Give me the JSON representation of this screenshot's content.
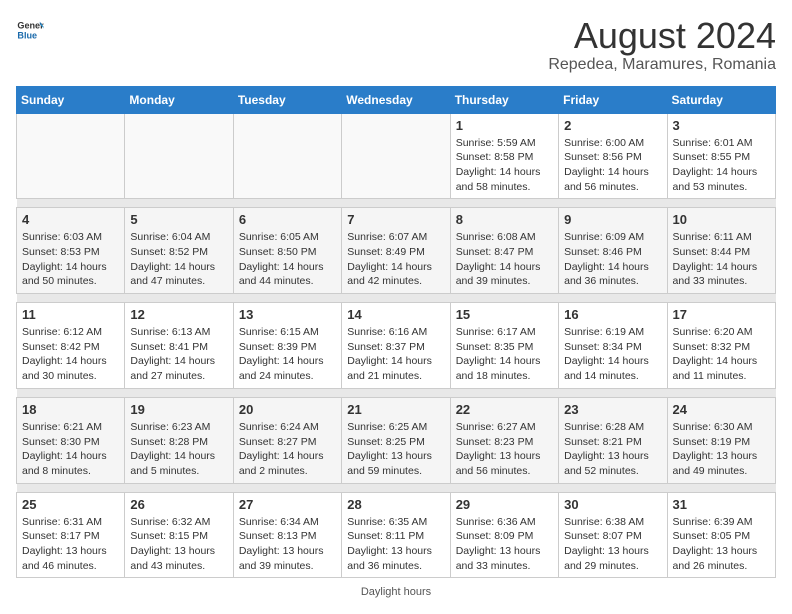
{
  "header": {
    "logo_general": "General",
    "logo_blue": "Blue",
    "main_title": "August 2024",
    "sub_title": "Repedea, Maramures, Romania"
  },
  "days_of_week": [
    "Sunday",
    "Monday",
    "Tuesday",
    "Wednesday",
    "Thursday",
    "Friday",
    "Saturday"
  ],
  "footer": {
    "daylight_note": "Daylight hours"
  },
  "weeks": [
    {
      "days": [
        {
          "num": "",
          "info": ""
        },
        {
          "num": "",
          "info": ""
        },
        {
          "num": "",
          "info": ""
        },
        {
          "num": "",
          "info": ""
        },
        {
          "num": "1",
          "info": "Sunrise: 5:59 AM\nSunset: 8:58 PM\nDaylight: 14 hours\nand 58 minutes."
        },
        {
          "num": "2",
          "info": "Sunrise: 6:00 AM\nSunset: 8:56 PM\nDaylight: 14 hours\nand 56 minutes."
        },
        {
          "num": "3",
          "info": "Sunrise: 6:01 AM\nSunset: 8:55 PM\nDaylight: 14 hours\nand 53 minutes."
        }
      ]
    },
    {
      "days": [
        {
          "num": "4",
          "info": "Sunrise: 6:03 AM\nSunset: 8:53 PM\nDaylight: 14 hours\nand 50 minutes."
        },
        {
          "num": "5",
          "info": "Sunrise: 6:04 AM\nSunset: 8:52 PM\nDaylight: 14 hours\nand 47 minutes."
        },
        {
          "num": "6",
          "info": "Sunrise: 6:05 AM\nSunset: 8:50 PM\nDaylight: 14 hours\nand 44 minutes."
        },
        {
          "num": "7",
          "info": "Sunrise: 6:07 AM\nSunset: 8:49 PM\nDaylight: 14 hours\nand 42 minutes."
        },
        {
          "num": "8",
          "info": "Sunrise: 6:08 AM\nSunset: 8:47 PM\nDaylight: 14 hours\nand 39 minutes."
        },
        {
          "num": "9",
          "info": "Sunrise: 6:09 AM\nSunset: 8:46 PM\nDaylight: 14 hours\nand 36 minutes."
        },
        {
          "num": "10",
          "info": "Sunrise: 6:11 AM\nSunset: 8:44 PM\nDaylight: 14 hours\nand 33 minutes."
        }
      ]
    },
    {
      "days": [
        {
          "num": "11",
          "info": "Sunrise: 6:12 AM\nSunset: 8:42 PM\nDaylight: 14 hours\nand 30 minutes."
        },
        {
          "num": "12",
          "info": "Sunrise: 6:13 AM\nSunset: 8:41 PM\nDaylight: 14 hours\nand 27 minutes."
        },
        {
          "num": "13",
          "info": "Sunrise: 6:15 AM\nSunset: 8:39 PM\nDaylight: 14 hours\nand 24 minutes."
        },
        {
          "num": "14",
          "info": "Sunrise: 6:16 AM\nSunset: 8:37 PM\nDaylight: 14 hours\nand 21 minutes."
        },
        {
          "num": "15",
          "info": "Sunrise: 6:17 AM\nSunset: 8:35 PM\nDaylight: 14 hours\nand 18 minutes."
        },
        {
          "num": "16",
          "info": "Sunrise: 6:19 AM\nSunset: 8:34 PM\nDaylight: 14 hours\nand 14 minutes."
        },
        {
          "num": "17",
          "info": "Sunrise: 6:20 AM\nSunset: 8:32 PM\nDaylight: 14 hours\nand 11 minutes."
        }
      ]
    },
    {
      "days": [
        {
          "num": "18",
          "info": "Sunrise: 6:21 AM\nSunset: 8:30 PM\nDaylight: 14 hours\nand 8 minutes."
        },
        {
          "num": "19",
          "info": "Sunrise: 6:23 AM\nSunset: 8:28 PM\nDaylight: 14 hours\nand 5 minutes."
        },
        {
          "num": "20",
          "info": "Sunrise: 6:24 AM\nSunset: 8:27 PM\nDaylight: 14 hours\nand 2 minutes."
        },
        {
          "num": "21",
          "info": "Sunrise: 6:25 AM\nSunset: 8:25 PM\nDaylight: 13 hours\nand 59 minutes."
        },
        {
          "num": "22",
          "info": "Sunrise: 6:27 AM\nSunset: 8:23 PM\nDaylight: 13 hours\nand 56 minutes."
        },
        {
          "num": "23",
          "info": "Sunrise: 6:28 AM\nSunset: 8:21 PM\nDaylight: 13 hours\nand 52 minutes."
        },
        {
          "num": "24",
          "info": "Sunrise: 6:30 AM\nSunset: 8:19 PM\nDaylight: 13 hours\nand 49 minutes."
        }
      ]
    },
    {
      "days": [
        {
          "num": "25",
          "info": "Sunrise: 6:31 AM\nSunset: 8:17 PM\nDaylight: 13 hours\nand 46 minutes."
        },
        {
          "num": "26",
          "info": "Sunrise: 6:32 AM\nSunset: 8:15 PM\nDaylight: 13 hours\nand 43 minutes."
        },
        {
          "num": "27",
          "info": "Sunrise: 6:34 AM\nSunset: 8:13 PM\nDaylight: 13 hours\nand 39 minutes."
        },
        {
          "num": "28",
          "info": "Sunrise: 6:35 AM\nSunset: 8:11 PM\nDaylight: 13 hours\nand 36 minutes."
        },
        {
          "num": "29",
          "info": "Sunrise: 6:36 AM\nSunset: 8:09 PM\nDaylight: 13 hours\nand 33 minutes."
        },
        {
          "num": "30",
          "info": "Sunrise: 6:38 AM\nSunset: 8:07 PM\nDaylight: 13 hours\nand 29 minutes."
        },
        {
          "num": "31",
          "info": "Sunrise: 6:39 AM\nSunset: 8:05 PM\nDaylight: 13 hours\nand 26 minutes."
        }
      ]
    }
  ]
}
